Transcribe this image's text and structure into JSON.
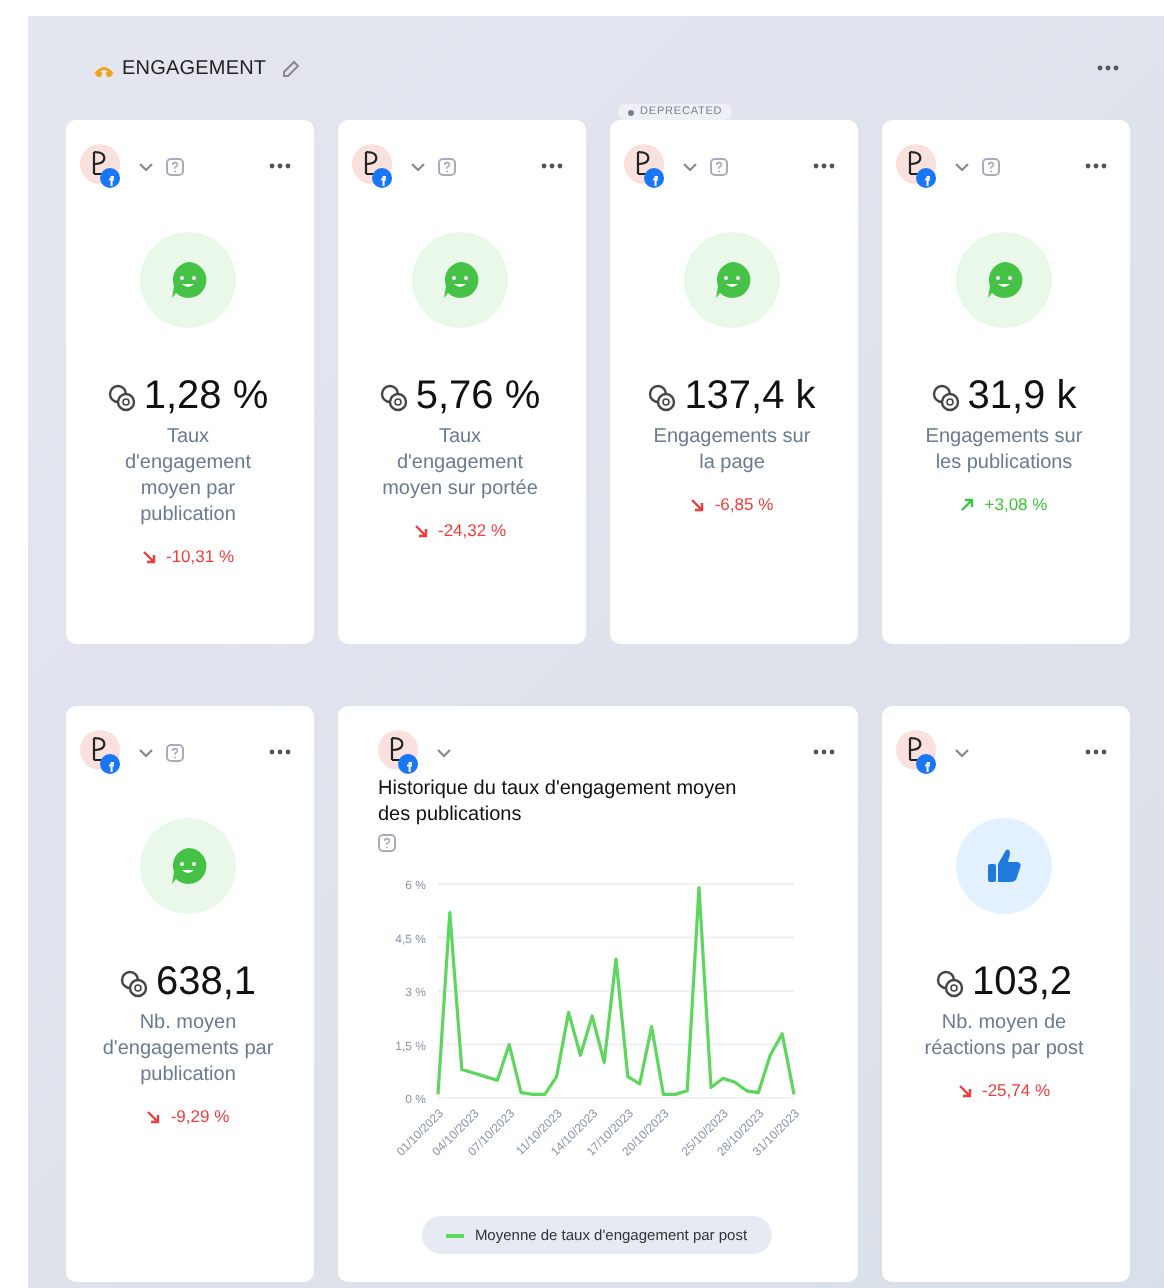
{
  "section": {
    "title": "ENGAGEMENT"
  },
  "cards": [
    {
      "kind": "engagement",
      "value": "1,28 %",
      "label": "Taux d'engagement moyen par publication",
      "trend": {
        "rising": false,
        "text": "-10,31 %"
      },
      "help": true,
      "menu": true
    },
    {
      "kind": "engagement",
      "value": "5,76 %",
      "label": "Taux d'engagement moyen sur portée",
      "trend": {
        "rising": false,
        "text": "-24,32 %"
      },
      "help": true,
      "menu": true
    },
    {
      "kind": "engagement",
      "value": "137,4 k",
      "label": "Engagements sur la page",
      "trend": {
        "rising": false,
        "text": "-6,85 %"
      },
      "help": true,
      "menu": true,
      "badge": "DEPRECATED"
    },
    {
      "kind": "engagement",
      "value": "31,9 k",
      "label": "Engagements sur les publications",
      "trend": {
        "rising": true,
        "text": "+3,08 %"
      },
      "help": true,
      "menu": true
    },
    {
      "kind": "engagement",
      "value": "638,1",
      "label": "Nb. moyen d'engagements par publication",
      "trend": {
        "rising": false,
        "text": "-9,29 %"
      },
      "help": true,
      "menu": true
    },
    {
      "kind": "chart",
      "title": "Historique du taux d'engagement moyen des publications",
      "help": true,
      "menu": true,
      "chart_data": {
        "type": "line",
        "categories": [
          "01/10/2023",
          null,
          null,
          "04/10/2023",
          null,
          null,
          "07/10/2023",
          null,
          null,
          null,
          "11/10/2023",
          null,
          null,
          "14/10/2023",
          null,
          null,
          "17/10/2023",
          null,
          null,
          "20/10/2023",
          null,
          null,
          null,
          null,
          "25/10/2023",
          null,
          null,
          "28/10/2023",
          null,
          null,
          "31/10/2023"
        ],
        "series": [
          {
            "name": "Moyenne de taux d'engagement par post",
            "color": "#5cd65c",
            "values": [
              0.1,
              5.2,
              0.8,
              0.7,
              0.6,
              0.5,
              1.5,
              0.15,
              0.1,
              0.1,
              0.6,
              2.4,
              1.2,
              2.3,
              1.0,
              3.9,
              0.6,
              0.4,
              2.0,
              0.1,
              0.1,
              0.2,
              5.9,
              0.3,
              0.55,
              0.45,
              0.2,
              0.15,
              1.2,
              1.8,
              0.1
            ]
          }
        ],
        "grid": true,
        "ylim": [
          0,
          6
        ],
        "yticks": [
          {
            "value": 0,
            "label": "0 %"
          },
          {
            "value": 1.5,
            "label": "1,5 %"
          },
          {
            "value": 3,
            "label": "3 %"
          },
          {
            "value": 4.5,
            "label": "4,5 %"
          },
          {
            "value": 6,
            "label": "6 %"
          }
        ]
      }
    },
    {
      "kind": "reactions",
      "value": "103,2",
      "label": "Nb. moyen de réactions par post",
      "trend": {
        "rising": false,
        "text": "-25,74 %"
      },
      "help": false,
      "menu": true
    }
  ]
}
